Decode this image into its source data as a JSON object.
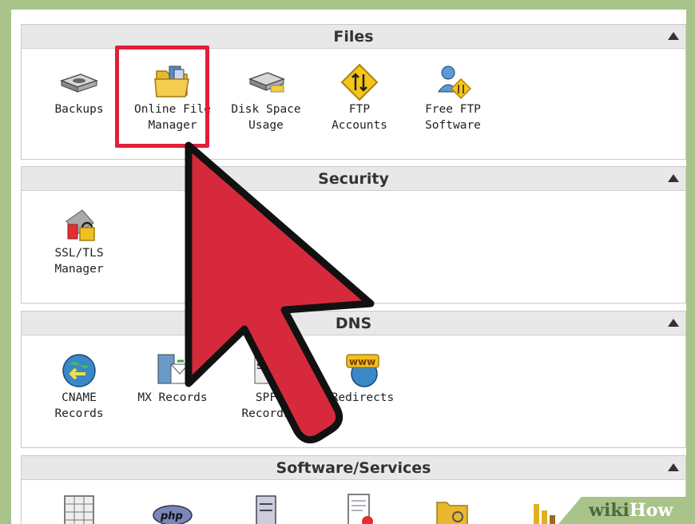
{
  "sections": {
    "files": {
      "title": "Files",
      "items": [
        {
          "label": "Backups",
          "icon": "disk-icon"
        },
        {
          "label": "Online File\nManager",
          "icon": "folder-icon"
        },
        {
          "label": "Disk Space\nUsage",
          "icon": "disk-usage-icon"
        },
        {
          "label": "FTP\nAccounts",
          "icon": "ftp-sign-icon"
        },
        {
          "label": "Free FTP\nSoftware",
          "icon": "ftp-software-icon"
        }
      ]
    },
    "security": {
      "title": "Security",
      "items": [
        {
          "label": "SSL/TLS\nManager",
          "icon": "ssl-lock-icon"
        }
      ]
    },
    "dns": {
      "title": "DNS",
      "items": [
        {
          "label": "CNAME\nRecords",
          "icon": "globe-arrow-icon"
        },
        {
          "label": "MX Records",
          "icon": "mx-server-icon"
        },
        {
          "label": "SPF\nRecords",
          "icon": "spf-icon"
        },
        {
          "label": "Redirects",
          "icon": "www-globe-icon"
        }
      ]
    },
    "software": {
      "title": "Software/Services",
      "items": [
        {
          "label": "",
          "icon": "calendar-icon"
        },
        {
          "label": "",
          "icon": "php-icon"
        },
        {
          "label": "",
          "icon": "server-icon"
        },
        {
          "label": "",
          "icon": "document-icon"
        },
        {
          "label": "",
          "icon": "folder-gear-icon"
        },
        {
          "label": "",
          "icon": "bar-chart-icon"
        }
      ]
    }
  },
  "watermark": {
    "part1": "wiki",
    "part2": "How"
  },
  "colors": {
    "highlight": "#e0203a",
    "cursor": "#d62a3c",
    "background": "#a8c48a"
  }
}
